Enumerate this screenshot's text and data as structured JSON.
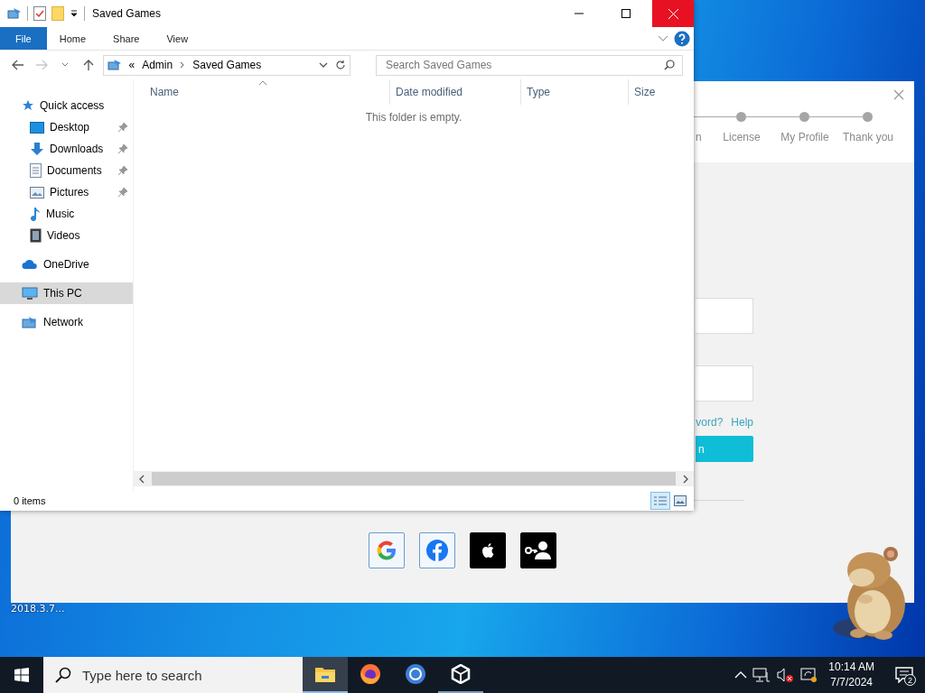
{
  "explorer": {
    "title": "Saved Games",
    "ribbon_tabs": [
      {
        "label": "File",
        "selected": true
      },
      {
        "label": "Home",
        "selected": false
      },
      {
        "label": "Share",
        "selected": false
      },
      {
        "label": "View",
        "selected": false
      }
    ],
    "history": {
      "back_disabled": false,
      "forward_disabled": true
    },
    "address": {
      "overflow": "«",
      "segments": [
        "Admin",
        "Saved Games"
      ]
    },
    "search": {
      "placeholder": "Search Saved Games"
    },
    "nav": [
      {
        "label": "Quick access",
        "selected": false,
        "children": [
          {
            "label": "Desktop",
            "pinned": true,
            "selected": false
          },
          {
            "label": "Downloads",
            "pinned": true,
            "selected": false
          },
          {
            "label": "Documents",
            "pinned": true,
            "selected": false
          },
          {
            "label": "Pictures",
            "pinned": true,
            "selected": false
          },
          {
            "label": "Music",
            "pinned": false,
            "selected": false
          },
          {
            "label": "Videos",
            "pinned": false,
            "selected": false
          }
        ]
      },
      {
        "label": "OneDrive",
        "selected": false
      },
      {
        "label": "This PC",
        "selected": true
      },
      {
        "label": "Network",
        "selected": false
      }
    ],
    "columns": [
      "Name",
      "Date modified",
      "Type",
      "Size"
    ],
    "empty_message": "This folder is empty.",
    "status": "0 items",
    "views": [
      {
        "kind": "details",
        "selected": true
      },
      {
        "kind": "large-icons",
        "selected": false
      }
    ]
  },
  "installer": {
    "steps": [
      {
        "label": "n"
      },
      {
        "label": "License"
      },
      {
        "label": "My Profile"
      },
      {
        "label": "Thank you"
      }
    ],
    "link_fragment": "vord?",
    "help_link": "Help",
    "button_fragment": "n",
    "social": [
      {
        "kind": "google"
      },
      {
        "kind": "facebook"
      },
      {
        "kind": "apple"
      },
      {
        "kind": "key-user"
      }
    ]
  },
  "desktop_label": "2018.3.7...",
  "taskbar": {
    "search_placeholder": "Type here to search",
    "apps": [
      {
        "kind": "explorer",
        "selected": true,
        "running": true
      },
      {
        "kind": "firefox",
        "selected": false,
        "running": false
      },
      {
        "kind": "chrome",
        "selected": false,
        "running": false
      },
      {
        "kind": "unity",
        "selected": false,
        "running": true
      }
    ],
    "time": "10:14 AM",
    "date": "7/7/2024",
    "notifications": "2"
  }
}
